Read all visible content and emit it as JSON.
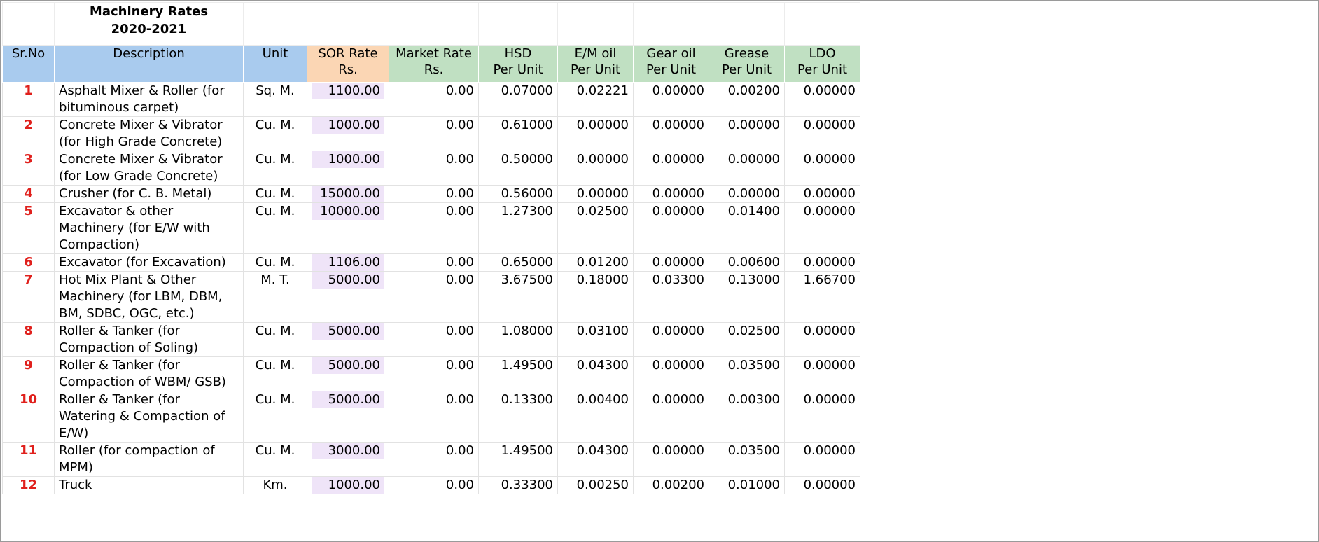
{
  "title": {
    "line1": "Machinery Rates",
    "line2": "2020-2021"
  },
  "headers": {
    "srno": "Sr.No",
    "description": "Description",
    "unit": "Unit",
    "sor_rate": [
      "SOR Rate",
      "Rs."
    ],
    "market_rate": [
      "Market Rate",
      "Rs."
    ],
    "hsd": [
      "HSD",
      "Per Unit"
    ],
    "em_oil": [
      "E/M oil",
      "Per Unit"
    ],
    "gear_oil": [
      "Gear oil",
      "Per Unit"
    ],
    "grease": [
      "Grease",
      "Per Unit"
    ],
    "ldo": [
      "LDO",
      "Per Unit"
    ]
  },
  "colors": {
    "header_blue": "#a9cbee",
    "header_peach": "#fbd6b4",
    "header_green": "#c0e0c2",
    "sor_cell": "#efe4f8",
    "serial_red": "#e0201c"
  },
  "rows": [
    {
      "sr": "1",
      "description": "Asphalt Mixer & Roller (for bituminous carpet)",
      "unit": "Sq. M.",
      "sor": "1100.00",
      "market": "0.00",
      "hsd": "0.07000",
      "em_oil": "0.02221",
      "gear_oil": "0.00000",
      "grease": "0.00200",
      "ldo": "0.00000"
    },
    {
      "sr": "2",
      "description": "Concrete Mixer & Vibrator (for High Grade Concrete)",
      "unit": "Cu. M.",
      "sor": "1000.00",
      "market": "0.00",
      "hsd": "0.61000",
      "em_oil": "0.00000",
      "gear_oil": "0.00000",
      "grease": "0.00000",
      "ldo": "0.00000"
    },
    {
      "sr": "3",
      "description": "Concrete Mixer & Vibrator (for Low Grade Concrete)",
      "unit": "Cu. M.",
      "sor": "1000.00",
      "market": "0.00",
      "hsd": "0.50000",
      "em_oil": "0.00000",
      "gear_oil": "0.00000",
      "grease": "0.00000",
      "ldo": "0.00000"
    },
    {
      "sr": "4",
      "description": "Crusher (for C. B. Metal)",
      "unit": "Cu. M.",
      "sor": "15000.00",
      "market": "0.00",
      "hsd": "0.56000",
      "em_oil": "0.00000",
      "gear_oil": "0.00000",
      "grease": "0.00000",
      "ldo": "0.00000"
    },
    {
      "sr": "5",
      "description": "Excavator & other Machinery (for E/W with Compaction)",
      "unit": "Cu. M.",
      "sor": "10000.00",
      "market": "0.00",
      "hsd": "1.27300",
      "em_oil": "0.02500",
      "gear_oil": "0.00000",
      "grease": "0.01400",
      "ldo": "0.00000"
    },
    {
      "sr": "6",
      "description": "Excavator (for Excavation)",
      "unit": "Cu. M.",
      "sor": "1106.00",
      "market": "0.00",
      "hsd": "0.65000",
      "em_oil": "0.01200",
      "gear_oil": "0.00000",
      "grease": "0.00600",
      "ldo": "0.00000"
    },
    {
      "sr": "7",
      "description": "Hot Mix Plant & Other Machinery (for LBM, DBM, BM, SDBC, OGC, etc.)",
      "unit": "M. T.",
      "sor": "5000.00",
      "market": "0.00",
      "hsd": "3.67500",
      "em_oil": "0.18000",
      "gear_oil": "0.03300",
      "grease": "0.13000",
      "ldo": "1.66700"
    },
    {
      "sr": "8",
      "description": "Roller & Tanker (for Compaction of Soling)",
      "unit": "Cu. M.",
      "sor": "5000.00",
      "market": "0.00",
      "hsd": "1.08000",
      "em_oil": "0.03100",
      "gear_oil": "0.00000",
      "grease": "0.02500",
      "ldo": "0.00000"
    },
    {
      "sr": "9",
      "description": "Roller & Tanker (for Compaction of WBM/ GSB)",
      "unit": "Cu. M.",
      "sor": "5000.00",
      "market": "0.00",
      "hsd": "1.49500",
      "em_oil": "0.04300",
      "gear_oil": "0.00000",
      "grease": "0.03500",
      "ldo": "0.00000"
    },
    {
      "sr": "10",
      "description": "Roller & Tanker (for Watering & Compaction of E/W)",
      "unit": "Cu. M.",
      "sor": "5000.00",
      "market": "0.00",
      "hsd": "0.13300",
      "em_oil": "0.00400",
      "gear_oil": "0.00000",
      "grease": "0.00300",
      "ldo": "0.00000"
    },
    {
      "sr": "11",
      "description": "Roller (for compaction of MPM)",
      "unit": "Cu. M.",
      "sor": "3000.00",
      "market": "0.00",
      "hsd": "1.49500",
      "em_oil": "0.04300",
      "gear_oil": "0.00000",
      "grease": "0.03500",
      "ldo": "0.00000"
    },
    {
      "sr": "12",
      "description": "Truck",
      "unit": "Km.",
      "sor": "1000.00",
      "market": "0.00",
      "hsd": "0.33300",
      "em_oil": "0.00250",
      "gear_oil": "0.00200",
      "grease": "0.01000",
      "ldo": "0.00000"
    }
  ]
}
